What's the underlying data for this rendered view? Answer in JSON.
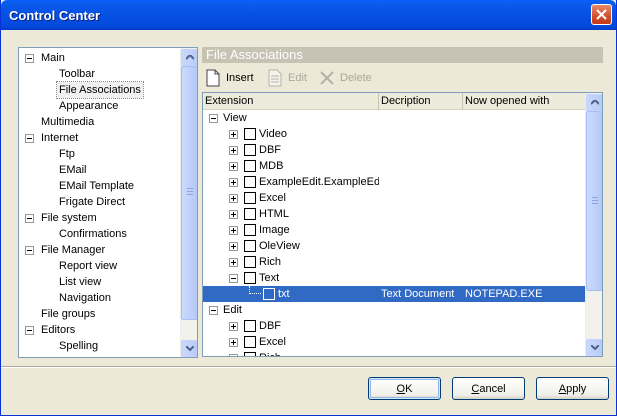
{
  "window": {
    "title": "Control Center"
  },
  "left_tree": {
    "items": [
      {
        "label": "Main",
        "level": 0,
        "expander": "minus"
      },
      {
        "label": "Toolbar",
        "level": 1
      },
      {
        "label": "File Associations",
        "level": 1,
        "selected": true
      },
      {
        "label": "Appearance",
        "level": 1
      },
      {
        "label": "Multimedia",
        "level": 0
      },
      {
        "label": "Internet",
        "level": 0,
        "expander": "minus"
      },
      {
        "label": "Ftp",
        "level": 1
      },
      {
        "label": "EMail",
        "level": 1
      },
      {
        "label": "EMail Template",
        "level": 1
      },
      {
        "label": "Frigate Direct",
        "level": 1
      },
      {
        "label": "File system",
        "level": 0,
        "expander": "minus"
      },
      {
        "label": "Confirmations",
        "level": 1
      },
      {
        "label": "File Manager",
        "level": 0,
        "expander": "minus"
      },
      {
        "label": "Report view",
        "level": 1
      },
      {
        "label": "List view",
        "level": 1
      },
      {
        "label": "Navigation",
        "level": 1
      },
      {
        "label": "File groups",
        "level": 0
      },
      {
        "label": "Editors",
        "level": 0,
        "expander": "minus"
      },
      {
        "label": "Spelling",
        "level": 1
      }
    ]
  },
  "panel": {
    "title": "File Associations"
  },
  "toolbar": {
    "insert": "Insert",
    "edit": "Edit",
    "delete": "Delete"
  },
  "columns": {
    "extension": "Extension",
    "description": "Decription",
    "opened_with": "Now opened with"
  },
  "list": {
    "rows": [
      {
        "label": "View",
        "level": 0,
        "expander": "minus",
        "checkbox": false
      },
      {
        "label": "Video",
        "level": 1,
        "expander": "plus",
        "checkbox": true
      },
      {
        "label": "DBF",
        "level": 1,
        "expander": "plus",
        "checkbox": true
      },
      {
        "label": "MDB",
        "level": 1,
        "expander": "plus",
        "checkbox": true
      },
      {
        "label": "ExampleEdit.ExampleEdit(",
        "level": 1,
        "expander": "plus",
        "checkbox": true
      },
      {
        "label": "Excel",
        "level": 1,
        "expander": "plus",
        "checkbox": true
      },
      {
        "label": "HTML",
        "level": 1,
        "expander": "plus",
        "checkbox": true
      },
      {
        "label": "Image",
        "level": 1,
        "expander": "plus",
        "checkbox": true
      },
      {
        "label": "OleView",
        "level": 1,
        "expander": "plus",
        "checkbox": true
      },
      {
        "label": "Rich",
        "level": 1,
        "expander": "plus",
        "checkbox": true
      },
      {
        "label": "Text",
        "level": 1,
        "expander": "minus",
        "checkbox": true
      },
      {
        "label": "txt",
        "level": 2,
        "checkbox": true,
        "selected": true,
        "description": "Text Document",
        "opened_with": "NOTEPAD.EXE"
      },
      {
        "label": "Edit",
        "level": 0,
        "expander": "minus",
        "checkbox": false
      },
      {
        "label": "DBF",
        "level": 1,
        "expander": "plus",
        "checkbox": true
      },
      {
        "label": "Excel",
        "level": 1,
        "expander": "plus",
        "checkbox": true
      },
      {
        "label": "Rich",
        "level": 1,
        "expander": "plus",
        "checkbox": true
      }
    ]
  },
  "buttons": {
    "ok": {
      "accel": "O",
      "rest": "K"
    },
    "cancel": {
      "accel": "C",
      "rest": "ancel"
    },
    "apply": {
      "accel": "A",
      "rest": "pply"
    }
  },
  "colors": {
    "title_bar": "#0753e5",
    "selection": "#316ac5",
    "section_header": "#c6c2b4",
    "dialog_bg": "#ece9d8"
  }
}
